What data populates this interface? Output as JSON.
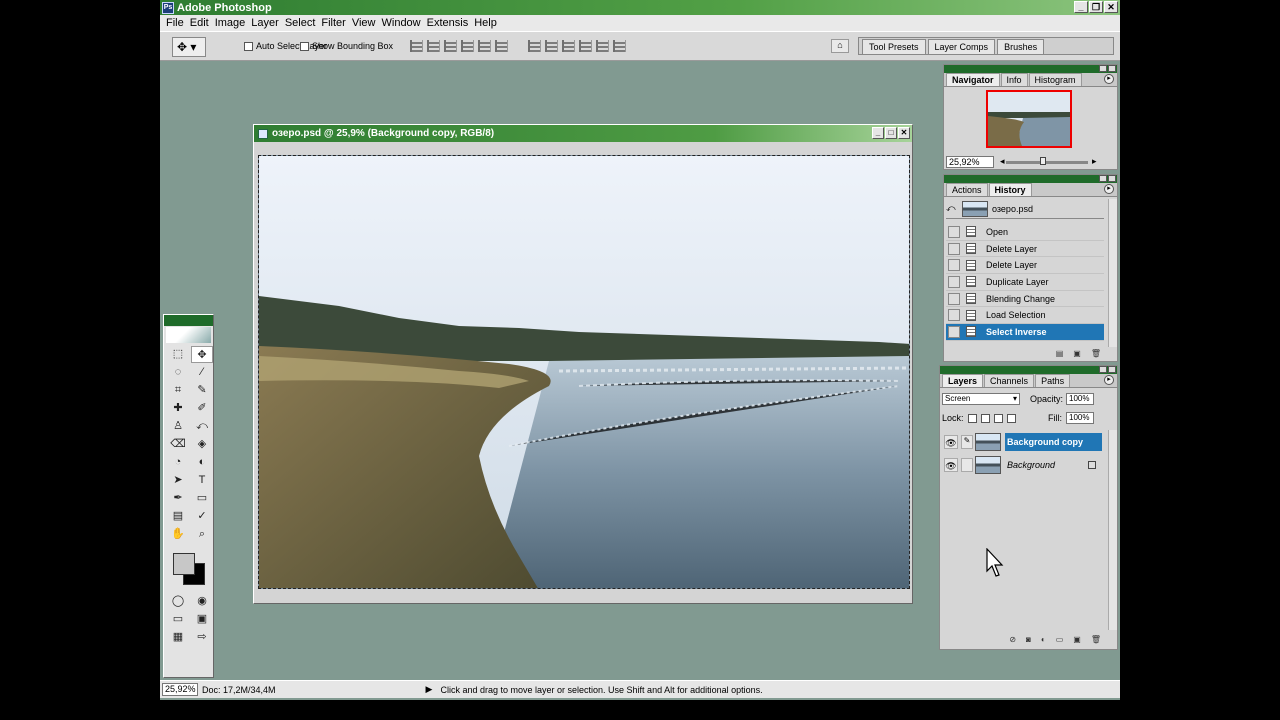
{
  "app": {
    "title": "Adobe Photoshop",
    "logo_text": "Ps",
    "window_buttons": [
      "_",
      "❐",
      "✕"
    ]
  },
  "menu": [
    "File",
    "Edit",
    "Image",
    "Layer",
    "Select",
    "Filter",
    "View",
    "Window",
    "Extensis",
    "Help"
  ],
  "options": {
    "tool_glyph": "✥",
    "auto_select_layer": "Auto Select Layer",
    "show_bounding_box": "Show Bounding Box",
    "well_icon_glyph": "⌂",
    "palette_well_tabs": [
      "Tool Presets",
      "Layer Comps",
      "Brushes"
    ]
  },
  "document": {
    "title": "озеро.psd @ 25,9% (Background copy, RGB/8)",
    "buttons": [
      "_",
      "□",
      "✕"
    ]
  },
  "toolbox": {
    "tools": [
      "⬚",
      "✥",
      "◌",
      "⁄",
      "⌗",
      "✎",
      "✚",
      "✐",
      "♙",
      "⤺",
      "⌫",
      "◈",
      "◔",
      "◐",
      "➤",
      "T",
      "✒",
      "▭",
      "▤",
      "✓",
      "✋",
      "⌕"
    ],
    "foreground_color": "#c7c7c7",
    "background_color": "#000000",
    "mode_buttons": [
      "◯",
      "◉",
      "▭",
      "▣",
      "▦",
      "⇨",
      "✓"
    ]
  },
  "navigator": {
    "tabs": [
      "Navigator",
      "Info",
      "Histogram"
    ],
    "active_tab": "Navigator",
    "zoom": "25,92%",
    "zoom_out_glyph": "◂",
    "zoom_in_glyph": "▸"
  },
  "history": {
    "tabs": [
      "Actions",
      "History"
    ],
    "active_tab": "History",
    "snapshot": "озеро.psd",
    "steps": [
      {
        "label": "Open",
        "current": false
      },
      {
        "label": "Delete Layer",
        "current": false
      },
      {
        "label": "Delete Layer",
        "current": false
      },
      {
        "label": "Duplicate Layer",
        "current": false
      },
      {
        "label": "Blending Change",
        "current": false
      },
      {
        "label": "Load Selection",
        "current": false
      },
      {
        "label": "Select Inverse",
        "current": true
      }
    ],
    "footer_icons": [
      "▤",
      "▣",
      "🗑"
    ]
  },
  "layers": {
    "tabs": [
      "Layers",
      "Channels",
      "Paths"
    ],
    "active_tab": "Layers",
    "blend_mode": "Screen",
    "opacity_label": "Opacity:",
    "opacity": "100%",
    "lock_label": "Lock:",
    "fill_label": "Fill:",
    "fill": "100%",
    "items": [
      {
        "name": "Background copy",
        "selected": true,
        "eye": "👁",
        "link": "✎"
      },
      {
        "name": "Background",
        "selected": false,
        "eye": "👁",
        "link": ""
      }
    ],
    "footer_icons": [
      "⊘",
      "◙",
      "◐",
      "▭",
      "▣",
      "🗑"
    ]
  },
  "status": {
    "zoom": "25,92%",
    "doc": "Doc: 17,2M/34,4M",
    "arrow": "▶",
    "message": "Click and drag to move layer or selection.  Use Shift and Alt for additional options."
  },
  "colors": {
    "title_green": "#2f7d32",
    "workspace": "#819a91",
    "selection_blue": "#2076b5"
  }
}
